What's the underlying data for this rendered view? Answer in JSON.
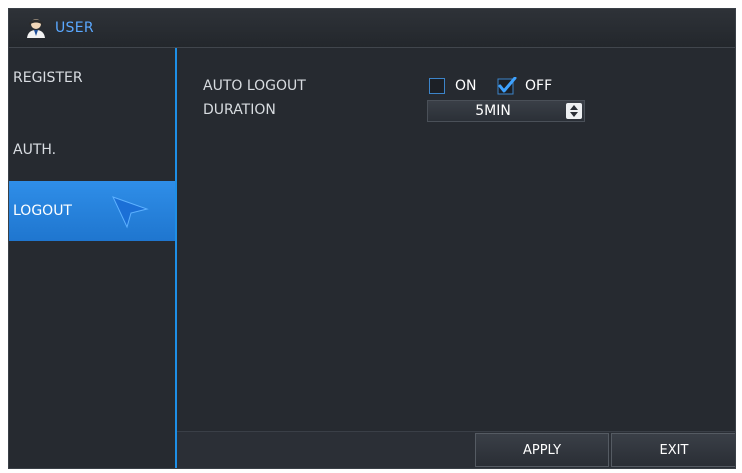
{
  "titlebar": {
    "title": "USER",
    "icon": "user-icon"
  },
  "sidebar": {
    "items": [
      {
        "label": "REGISTER",
        "active": false
      },
      {
        "label": "AUTH.",
        "active": false
      },
      {
        "label": "LOGOUT",
        "active": true
      }
    ],
    "cursor_icon": "pointer-cursor-icon"
  },
  "settings": {
    "auto_logout_label": "AUTO LOGOUT",
    "on_label": "ON",
    "off_label": "OFF",
    "on_checked": false,
    "off_checked": true,
    "duration_label": "DURATION",
    "duration_value": "5MIN"
  },
  "footer": {
    "apply_label": "APPLY",
    "exit_label": "EXIT"
  },
  "colors": {
    "accent": "#1e8fe6",
    "background": "#262a30",
    "title_text": "#5aa8ff"
  }
}
